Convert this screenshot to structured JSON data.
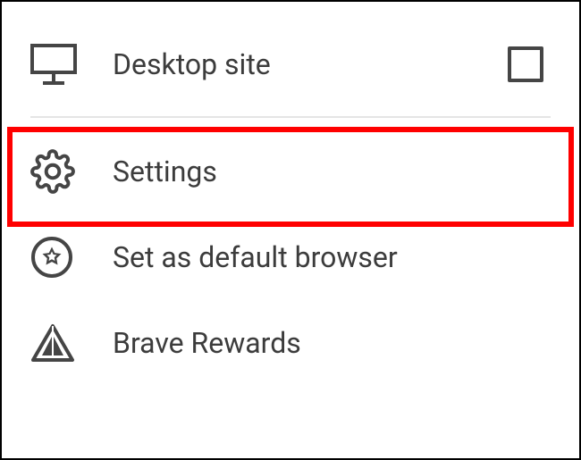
{
  "menu": {
    "desktop_site": {
      "label": "Desktop site",
      "checked": false
    },
    "settings": {
      "label": "Settings"
    },
    "default_browser": {
      "label": "Set as default browser"
    },
    "brave_rewards": {
      "label": "Brave Rewards"
    }
  },
  "colors": {
    "icon": "#454545",
    "text": "#3c3c3c",
    "highlight": "#ff0000"
  }
}
